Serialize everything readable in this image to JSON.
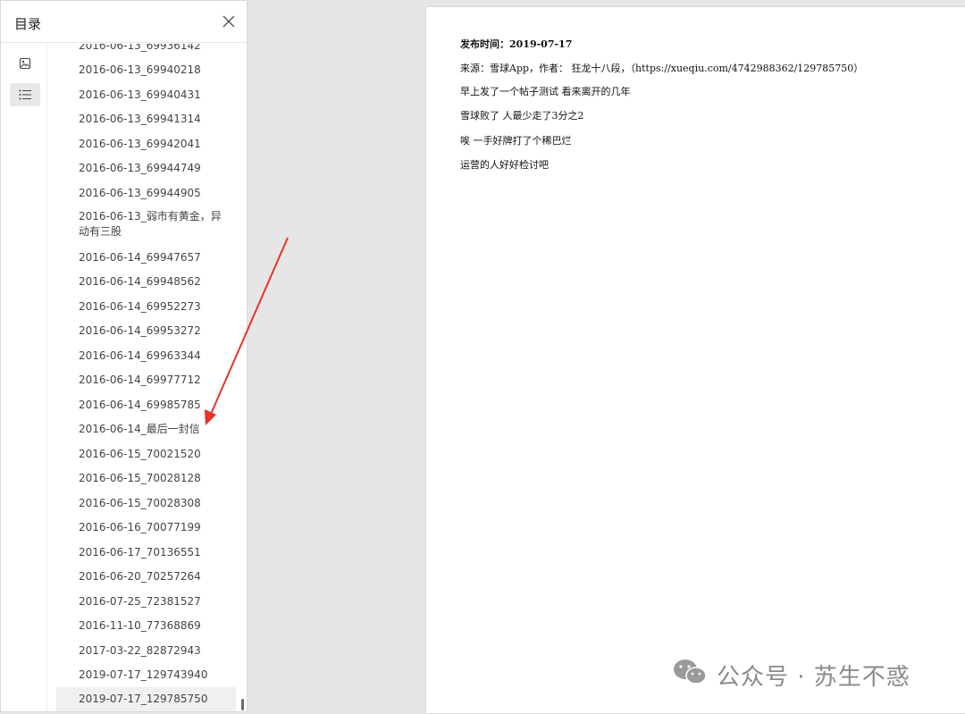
{
  "sidebar": {
    "title": "目录",
    "close_icon": "close-icon",
    "rail": [
      {
        "icon": "image-thumbnail-icon",
        "active": false
      },
      {
        "icon": "list-outline-icon",
        "active": true
      }
    ],
    "toc_items": [
      {
        "label": "2016-06-13_69936142"
      },
      {
        "label": "2016-06-13_69940218"
      },
      {
        "label": "2016-06-13_69940431"
      },
      {
        "label": "2016-06-13_69941314"
      },
      {
        "label": "2016-06-13_69942041"
      },
      {
        "label": "2016-06-13_69944749"
      },
      {
        "label": "2016-06-13_69944905"
      },
      {
        "label": "2016-06-13_弱市有黄金，异动有三股"
      },
      {
        "label": "2016-06-14_69947657"
      },
      {
        "label": "2016-06-14_69948562"
      },
      {
        "label": "2016-06-14_69952273"
      },
      {
        "label": "2016-06-14_69953272"
      },
      {
        "label": "2016-06-14_69963344"
      },
      {
        "label": "2016-06-14_69977712"
      },
      {
        "label": "2016-06-14_69985785"
      },
      {
        "label": "2016-06-14_最后一封信"
      },
      {
        "label": "2016-06-15_70021520"
      },
      {
        "label": "2016-06-15_70028128"
      },
      {
        "label": "2016-06-15_70028308"
      },
      {
        "label": "2016-06-16_70077199"
      },
      {
        "label": "2016-06-17_70136551"
      },
      {
        "label": "2016-06-20_70257264"
      },
      {
        "label": "2016-07-25_72381527"
      },
      {
        "label": "2016-11-10_77368869"
      },
      {
        "label": "2017-03-22_82872943"
      },
      {
        "label": "2019-07-17_129743940"
      },
      {
        "label": "2019-07-17_129785750",
        "selected": true
      }
    ],
    "accent_color": "#0f62c9"
  },
  "document": {
    "lines": [
      {
        "text": "发布时间：2019-07-17",
        "bold": true
      },
      {
        "text": "来源：雪球App，作者： 狂龙十八段，（https://xueqiu.com/4742988362/129785750）",
        "bold": false
      },
      {
        "text": "早上发了一个帖子测试 看来离开的几年",
        "bold": false
      },
      {
        "text": "雪球败了 人最少走了3分之2",
        "bold": false
      },
      {
        "text": "唉 一手好牌打了个稀巴烂",
        "bold": false
      },
      {
        "text": "运营的人好好检讨吧",
        "bold": false
      }
    ]
  },
  "watermark": {
    "icon": "wechat-icon",
    "text": "公众号 · 苏生不惑"
  },
  "annotation": {
    "arrow_color": "#e8312a"
  }
}
